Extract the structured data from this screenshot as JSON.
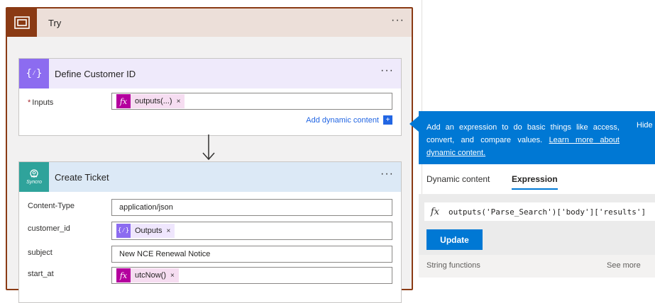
{
  "try_scope": {
    "title": "Try",
    "more_label": "···"
  },
  "define_card": {
    "title": "Define Customer ID",
    "more_label": "···",
    "inputs_label": "Inputs",
    "required_mark": "*",
    "token_label": "outputs(...)",
    "token_remove": "×",
    "add_dynamic_label": "Add dynamic content",
    "add_dynamic_plus": "+"
  },
  "ticket_card": {
    "title": "Create Ticket",
    "more_label": "···",
    "icon_label": "Syncro",
    "fields": {
      "content_type": {
        "label": "Content-Type",
        "value": "application/json"
      },
      "customer_id": {
        "label": "customer_id",
        "token": "Outputs",
        "remove": "×"
      },
      "subject": {
        "label": "subject",
        "value": "New NCE Renewal Notice"
      },
      "start_at": {
        "label": "start_at",
        "token": "utcNow()",
        "remove": "×"
      }
    }
  },
  "callout": {
    "text": "Add an expression to do basic things like access, convert, and compare values.",
    "link": "Learn more about dynamic content.",
    "hide": "Hide"
  },
  "tabs": {
    "dynamic": "Dynamic content",
    "expression": "Expression"
  },
  "expression": {
    "fx": "fx",
    "value": "outputs('Parse_Search')['body']['results']",
    "update_label": "Update",
    "string_functions": "String functions",
    "see_more": "See more"
  },
  "icons": {
    "try": "scope-icon",
    "define": "variable-braces-icon",
    "ticket": "syncro-logo-icon",
    "fx": "function-icon"
  },
  "colors": {
    "scope_accent": "#8a3a14",
    "variable_accent": "#8c6cf0",
    "syncro_accent": "#2fa39b",
    "expression_token": "#b4009e",
    "primary": "#0078d4"
  }
}
